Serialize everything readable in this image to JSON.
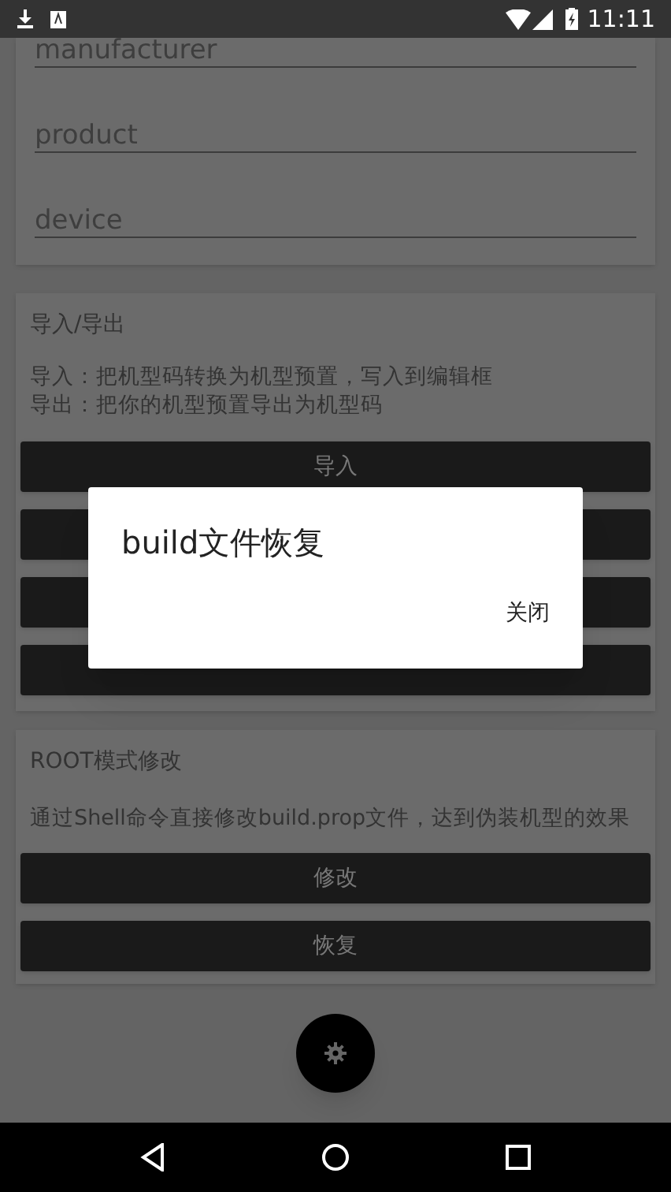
{
  "status_bar": {
    "time": "11:11"
  },
  "device_card": {
    "fields": [
      {
        "placeholder": "manufacturer"
      },
      {
        "placeholder": "product"
      },
      {
        "placeholder": "device"
      }
    ]
  },
  "import_card": {
    "title": "导入/导出",
    "description_lines": [
      "导入：把机型码转换为机型预置，写入到编辑框",
      "导出：把你的机型预置导出为机型码"
    ],
    "buttons": [
      {
        "kind": "labeled",
        "label": "导入"
      },
      {
        "kind": "blank"
      },
      {
        "kind": "blank"
      },
      {
        "kind": "blank"
      }
    ]
  },
  "root_card": {
    "title": "ROOT模式修改",
    "description": "通过Shell命令直接修改build.prop文件，达到伪装机型的效果",
    "buttons": [
      {
        "label": "修改"
      },
      {
        "label": "恢复"
      }
    ]
  },
  "dialog": {
    "title": "build文件恢复",
    "button": "关闭"
  }
}
